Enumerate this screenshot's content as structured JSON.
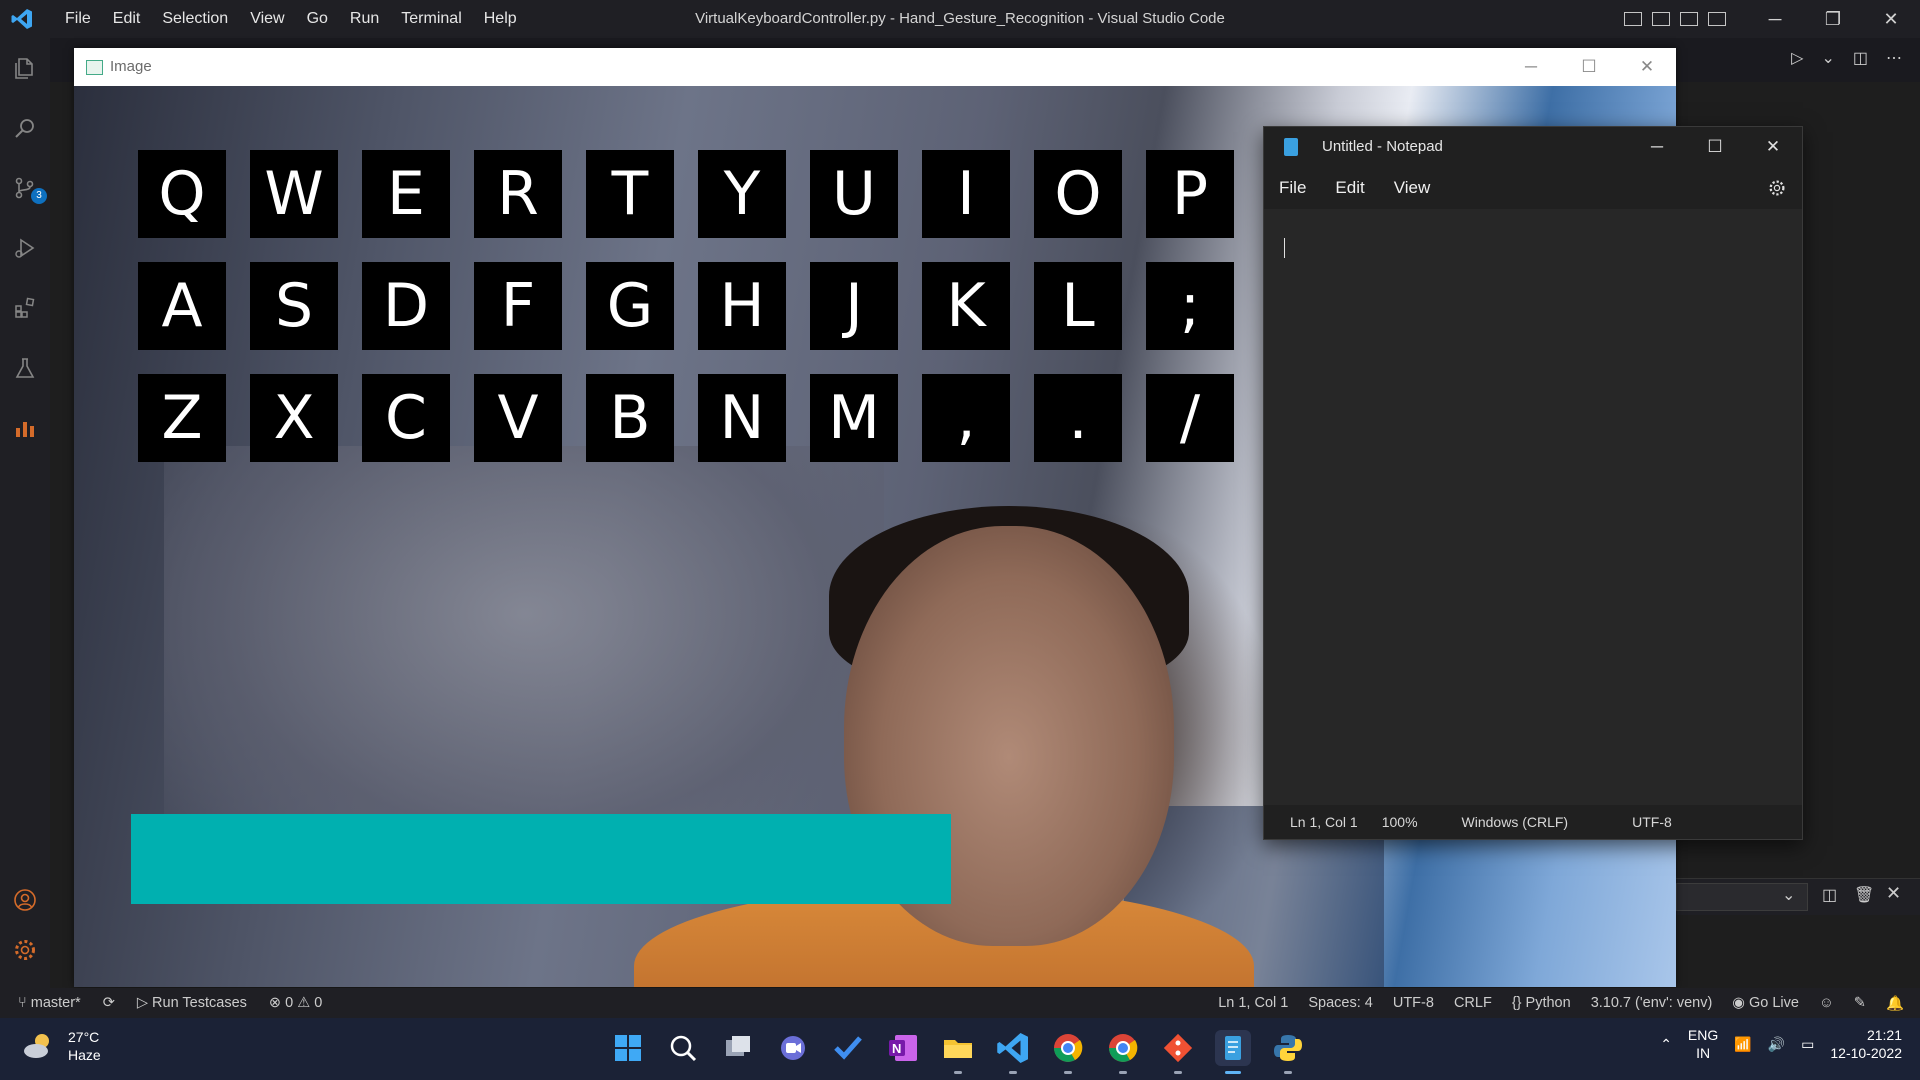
{
  "vscode": {
    "menu": [
      "File",
      "Edit",
      "Selection",
      "View",
      "Go",
      "Run",
      "Terminal",
      "Help"
    ],
    "window_title": "VirtualKeyboardController.py - Hand_Gesture_Recognition - Visual Studio Code",
    "scm_badge": "3"
  },
  "image_window": {
    "title": "Image",
    "keyboard_rows": [
      [
        "Q",
        "W",
        "E",
        "R",
        "T",
        "Y",
        "U",
        "I",
        "O",
        "P"
      ],
      [
        "A",
        "S",
        "D",
        "F",
        "G",
        "H",
        "J",
        "K",
        "L",
        ";"
      ],
      [
        "Z",
        "X",
        "C",
        "V",
        "B",
        "N",
        "M",
        ",",
        ".",
        "/"
      ]
    ],
    "typed_text": "",
    "typed_bar_color": "#00b0b0"
  },
  "notepad": {
    "title": "Untitled - Notepad",
    "menu": [
      "File",
      "Edit",
      "View"
    ],
    "content": "",
    "status": {
      "position": "Ln 1, Col 1",
      "zoom": "100%",
      "line_ending": "Windows (CRLF)",
      "encoding": "UTF-8"
    }
  },
  "statusbar": {
    "branch": "master*",
    "run_testcases": "Run Testcases",
    "errors": "0",
    "warnings": "0",
    "position": "Ln 1, Col 1",
    "spaces": "Spaces: 4",
    "encoding": "UTF-8",
    "eol": "CRLF",
    "language": "Python",
    "interpreter": "3.10.7 ('env': venv)",
    "go_live": "Go Live"
  },
  "taskbar": {
    "temperature": "27°C",
    "weather": "Haze",
    "lang_top": "ENG",
    "lang_bottom": "IN",
    "time": "21:21",
    "date": "12-10-2022",
    "apps": [
      "start-icon",
      "search-icon",
      "task-view-icon",
      "chat-icon",
      "todo-icon",
      "onenote-icon",
      "file-explorer-icon",
      "vscode-icon",
      "chrome-icon",
      "chrome-profile-icon",
      "git-icon",
      "notepad-icon",
      "python-icon"
    ]
  }
}
